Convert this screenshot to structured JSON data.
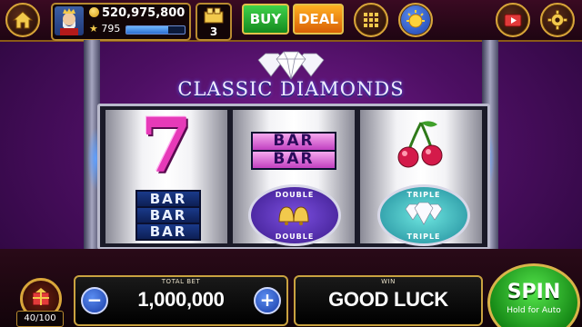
{
  "balance": {
    "coins": "520,975,800",
    "level": "795",
    "xp_fraction": 0.72
  },
  "inbox": {
    "count": "3"
  },
  "header": {
    "buy_label": "BUY",
    "deal_label": "DEAL"
  },
  "game": {
    "title": "CLASSIC DIAMONDS"
  },
  "reels": {
    "reel1": {
      "seven": "7",
      "bar3": [
        "BAR",
        "BAR",
        "BAR"
      ]
    },
    "reel2": {
      "bar2": [
        "BAR",
        "BAR"
      ],
      "badge_top": "DOUBLE",
      "badge_bottom": "DOUBLE"
    },
    "reel3": {
      "badge_top": "TRIPLE",
      "badge_bottom": "TRIPLE"
    }
  },
  "bottom": {
    "bonus_count": "40/100",
    "total_bet_label": "TOTAL BET",
    "total_bet_value": "1,000,000",
    "minus": "−",
    "plus": "+",
    "win_label": "WIN",
    "win_value": "GOOD LUCK",
    "spin_label": "SPIN",
    "spin_sub": "Hold for Auto"
  },
  "icons": [
    "home-icon",
    "coin-icon",
    "star-icon",
    "inbox-icon",
    "grid-menu-icon",
    "sun-icon",
    "video-icon",
    "gear-icon",
    "bonus-icon"
  ],
  "colors": {
    "accent_gold": "#d9a63a",
    "buy_green": "#148a1f",
    "deal_orange": "#d95f06",
    "spin_green": "#178a17"
  }
}
